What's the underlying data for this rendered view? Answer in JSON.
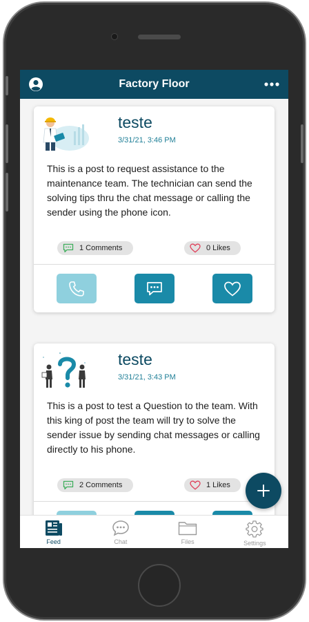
{
  "header": {
    "title": "Factory Floor"
  },
  "posts": [
    {
      "author": "teste",
      "date": "3/31/21, 3:46 PM",
      "body": "This is a post to request assistance to the maintenance team. The technician can send the solving tips thru the chat message or calling the sender using the phone icon.",
      "comments_label": "1 Comments",
      "likes_label": "0 Likes"
    },
    {
      "author": "teste",
      "date": "3/31/21, 3:43 PM",
      "body": "This is a post to test a Question to the team. With this king of post the team will try to solve the sender issue by sending chat messages or calling directly to his phone.",
      "comments_label": "2 Comments",
      "likes_label": "1 Likes"
    }
  ],
  "tabs": [
    {
      "label": "Feed",
      "icon": "newspaper-icon",
      "active": true
    },
    {
      "label": "Chat",
      "icon": "chat-bubble-icon",
      "active": false
    },
    {
      "label": "Files",
      "icon": "folder-icon",
      "active": false
    },
    {
      "label": "Settings",
      "icon": "gear-icon",
      "active": false
    }
  ],
  "colors": {
    "brand": "#0d4a62",
    "accent": "#1a8aa8",
    "accent_light": "#8fd0de",
    "heart": "#e0405a",
    "comment": "#3fae5c"
  }
}
